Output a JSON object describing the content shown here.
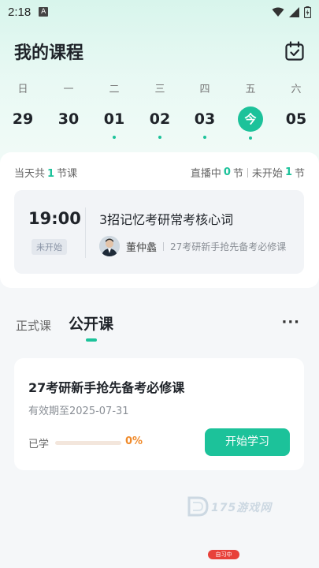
{
  "status_bar": {
    "time": "2:18",
    "a_badge": "A"
  },
  "header": {
    "title": "我的课程"
  },
  "week": [
    {
      "weekday": "日",
      "date": "29",
      "has_class": false,
      "today": false
    },
    {
      "weekday": "一",
      "date": "30",
      "has_class": false,
      "today": false
    },
    {
      "weekday": "二",
      "date": "01",
      "has_class": true,
      "today": false
    },
    {
      "weekday": "三",
      "date": "02",
      "has_class": true,
      "today": false
    },
    {
      "weekday": "四",
      "date": "03",
      "has_class": true,
      "today": false
    },
    {
      "weekday": "五",
      "date": "今",
      "has_class": true,
      "today": true
    },
    {
      "weekday": "六",
      "date": "05",
      "has_class": false,
      "today": false
    }
  ],
  "summary": {
    "day_prefix": "当天共",
    "day_count": "1",
    "day_suffix": "节课",
    "live_prefix": "直播中",
    "live_count": "0",
    "live_suffix": "节",
    "pending_prefix": "未开始",
    "pending_count": "1",
    "pending_suffix": "节"
  },
  "lesson": {
    "time": "19:00",
    "status": "未开始",
    "title": "3招记忆考研常考核心词",
    "teacher": "董仲蠡",
    "course": "27考研新手抢先备考必修课"
  },
  "tabs": [
    {
      "label": "正式课",
      "active": false
    },
    {
      "label": "公开课",
      "active": true
    }
  ],
  "more_label": "···",
  "course_card": {
    "title": "27考研新手抢先备考必修课",
    "valid_until": "有效期至2025-07-31",
    "learned_label": "已学",
    "progress_fraction": 0,
    "progress_text": "0%",
    "start_button": "开始学习"
  },
  "watermark": {
    "text": "175游戏网"
  },
  "bottom_badge": {
    "text": "自习中"
  },
  "colors": {
    "accent": "#1cc29a",
    "progress": "#f08a2a"
  }
}
